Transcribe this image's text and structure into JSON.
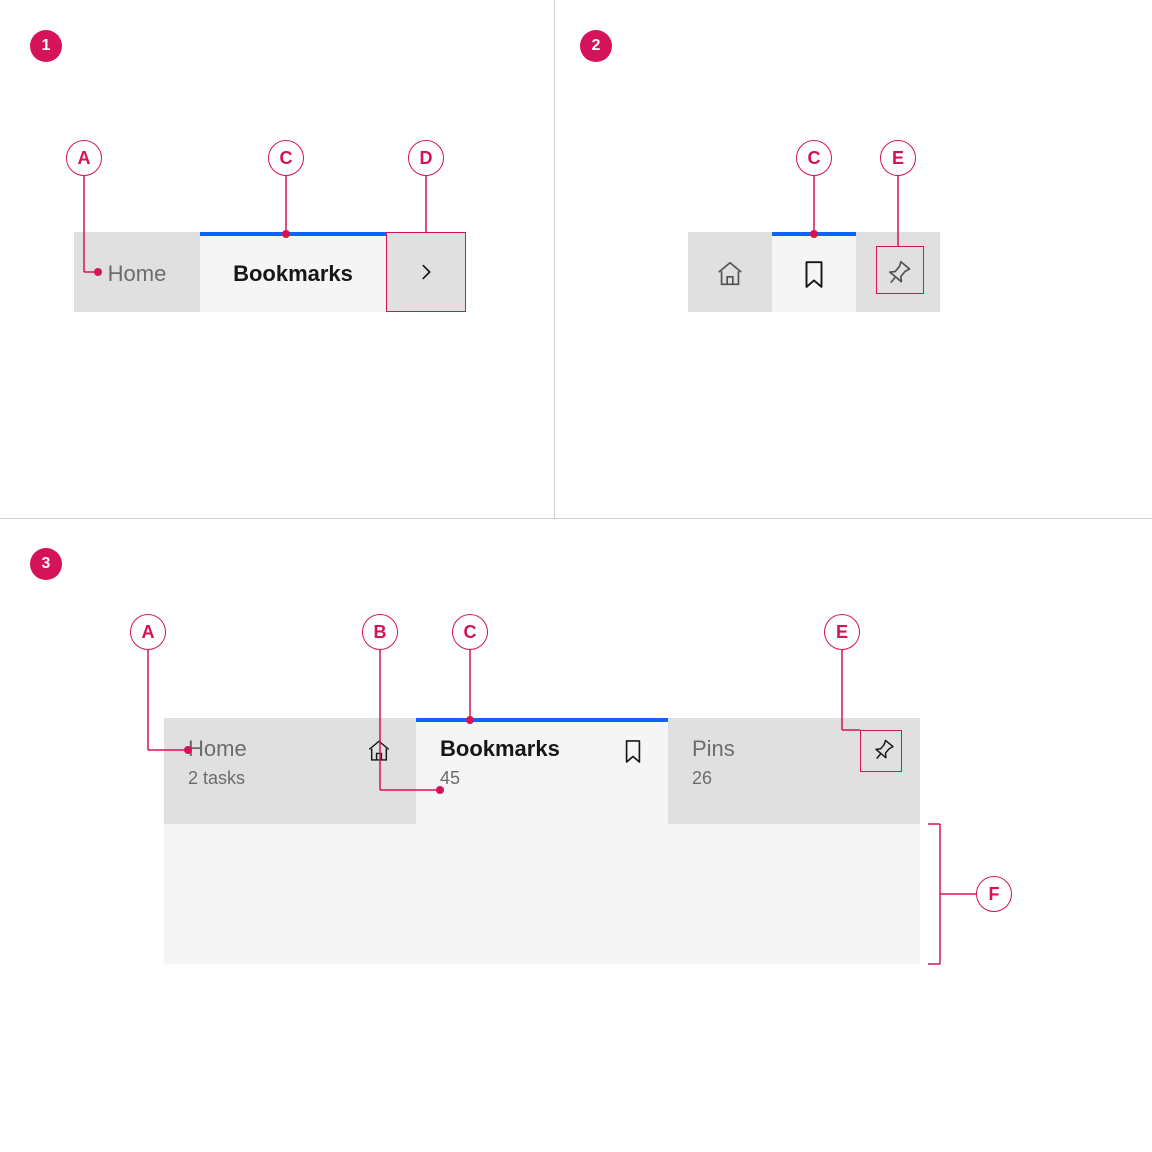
{
  "colors": {
    "accent": "#d5135a",
    "blue": "#0f62fe",
    "tab_bg": "#e0e0e0",
    "tab_selected_bg": "#f5f5f5"
  },
  "sections": {
    "s1": "1",
    "s2": "2",
    "s3": "3"
  },
  "callouts": {
    "A": "A",
    "B": "B",
    "C": "C",
    "D": "D",
    "E": "E",
    "F": "F"
  },
  "section1": {
    "tabs": [
      {
        "label": "Home"
      },
      {
        "label": "Bookmarks"
      }
    ],
    "overflow_icon": "chevron-right"
  },
  "section2": {
    "tabs": [
      {
        "icon": "home"
      },
      {
        "icon": "bookmark"
      },
      {
        "icon": "pin"
      }
    ]
  },
  "section3": {
    "tabs": [
      {
        "label": "Home",
        "sub": "2 tasks",
        "icon": "home"
      },
      {
        "label": "Bookmarks",
        "sub": "45",
        "icon": "bookmark"
      },
      {
        "label": "Pins",
        "sub": "26",
        "icon": "pin"
      }
    ]
  }
}
